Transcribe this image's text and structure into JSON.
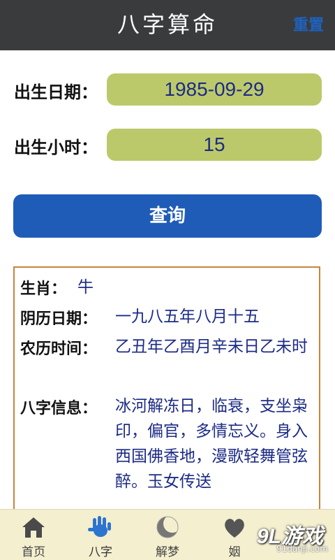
{
  "header": {
    "title": "八字算命",
    "reset_label": "重置"
  },
  "form": {
    "birth_date_label": "出生日期：",
    "birth_date_value": "1985-09-29",
    "birth_hour_label": "出生小时：",
    "birth_hour_value": "15",
    "query_label": "查询"
  },
  "result": {
    "zodiac_label": "生肖：",
    "zodiac_value": "牛",
    "lunar_date_label": "阴历日期：",
    "lunar_date_value": "一九八五年八月十五",
    "farmer_time_label": "农历时间：",
    "farmer_time_value": "乙丑年乙酉月辛未日乙未时",
    "bazi_label": "八字信息：",
    "bazi_value": "冰河解冻日，临衰，支坐枭印，偏官，多情忘义。身入西国佛香地，漫歌轻舞管弦醉。玉女传送"
  },
  "tabs": [
    {
      "label": "首页",
      "icon": "home-icon"
    },
    {
      "label": "八字",
      "icon": "hand-icon"
    },
    {
      "label": "解梦",
      "icon": "moon-icon"
    },
    {
      "label": "姻",
      "icon": "heart-icon"
    }
  ],
  "watermark": {
    "main": "9L游戏",
    "sub": "91danji.com"
  },
  "colors": {
    "header_bg": "#3a3b3d",
    "accent_blue": "#1f5cb8",
    "field_bg": "#bcc96a",
    "value_text": "#1c2b86",
    "tabbar_bg": "#f4efcf",
    "result_border": "#c8843c"
  }
}
